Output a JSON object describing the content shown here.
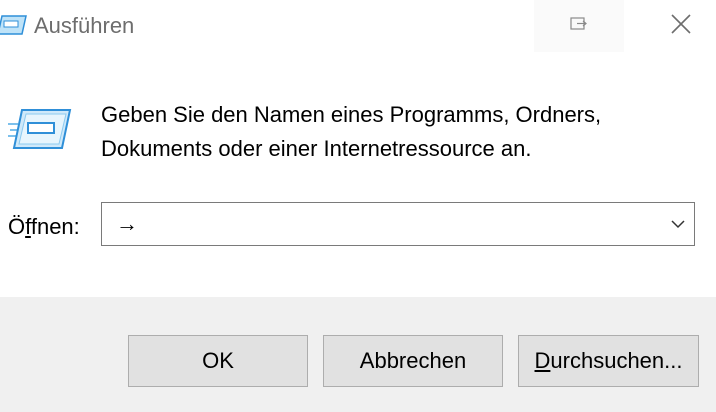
{
  "window": {
    "title": "Ausführen",
    "title_icon": "run-dialog-icon",
    "restore_icon": "snap-restore-icon",
    "close_icon": "close-icon"
  },
  "content": {
    "icon": "run-program-icon",
    "description_line1": "Geben Sie den Namen eines Programms, Ordners,",
    "description_line2": "Dokuments oder einer Internetressource an."
  },
  "open_field": {
    "label_prefix": "Ö",
    "label_mnemonic": "f",
    "label_suffix": "fnen:",
    "value": "→",
    "dropdown_icon": "chevron-down-icon"
  },
  "buttons": {
    "ok_label": "OK",
    "cancel_label": "Abbrechen",
    "browse_mnemonic": "D",
    "browse_rest": "urchsuchen..."
  },
  "colors": {
    "footer_background": "#f0f0f0",
    "button_background": "#e1e1e1",
    "button_border": "#adadad",
    "title_text": "#6d6d6d",
    "icon_blue": "#2f8fd8"
  }
}
